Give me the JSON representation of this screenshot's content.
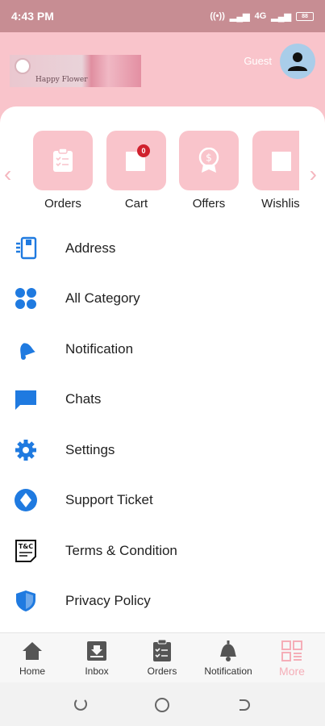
{
  "status_bar": {
    "time": "4:43 PM",
    "network": "4G",
    "battery": "88"
  },
  "header": {
    "logo_text": "Happy Flower",
    "guest_label": "Guest"
  },
  "quick_actions": [
    {
      "label": "Orders",
      "icon": "clipboard-icon"
    },
    {
      "label": "Cart",
      "icon": "cart-icon",
      "badge": "0"
    },
    {
      "label": "Offers",
      "icon": "offer-badge-icon"
    },
    {
      "label": "Wishlist",
      "icon": "wishlist-icon"
    }
  ],
  "menu": [
    {
      "label": "Address",
      "icon": "address-book-icon"
    },
    {
      "label": "All Category",
      "icon": "category-grid-icon"
    },
    {
      "label": "Notification",
      "icon": "bell-icon"
    },
    {
      "label": "Chats",
      "icon": "chat-bubble-icon"
    },
    {
      "label": "Settings",
      "icon": "gear-icon"
    },
    {
      "label": "Support Ticket",
      "icon": "support-diamond-icon"
    },
    {
      "label": "Terms & Condition",
      "icon": "terms-document-icon"
    },
    {
      "label": "Privacy Policy",
      "icon": "shield-icon"
    }
  ],
  "bottom_nav": [
    {
      "label": "Home",
      "icon": "home-icon"
    },
    {
      "label": "Inbox",
      "icon": "inbox-icon"
    },
    {
      "label": "Orders",
      "icon": "orders-icon"
    },
    {
      "label": "Notification",
      "icon": "bell-icon"
    },
    {
      "label": "More",
      "icon": "more-grid-icon",
      "active": true
    }
  ],
  "colors": {
    "status_bar": "#c78d93",
    "header": "#f9c4cb",
    "accent_blue": "#1f7ae0",
    "active_nav": "#f5aeb8",
    "badge": "#d0202d"
  }
}
